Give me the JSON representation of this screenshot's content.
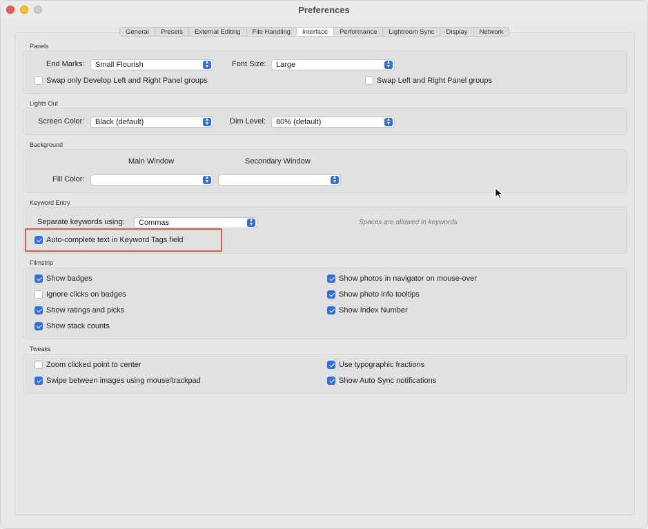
{
  "window": {
    "title": "Preferences"
  },
  "tabs": [
    "General",
    "Presets",
    "External Editing",
    "File Handling",
    "Interface",
    "Performance",
    "Lightroom Sync",
    "Display",
    "Network"
  ],
  "active_tab": "Interface",
  "panels": {
    "section_label": "Panels",
    "end_marks_label": "End Marks:",
    "end_marks_value": "Small Flourish",
    "font_size_label": "Font Size:",
    "font_size_value": "Large",
    "swap_develop": {
      "label": "Swap only Develop Left and Right Panel groups",
      "checked": false
    },
    "swap_lr": {
      "label": "Swap Left and Right Panel groups",
      "checked": false
    }
  },
  "lights_out": {
    "section_label": "Lights Out",
    "screen_color_label": "Screen Color:",
    "screen_color_value": "Black (default)",
    "dim_level_label": "Dim Level:",
    "dim_level_value": "80% (default)"
  },
  "background": {
    "section_label": "Background",
    "main_window_label": "Main Window",
    "secondary_window_label": "Secondary Window",
    "fill_color_label": "Fill Color:",
    "main_fill_value": "",
    "secondary_fill_value": ""
  },
  "keyword_entry": {
    "section_label": "Keyword Entry",
    "separate_label": "Separate keywords using:",
    "separate_value": "Commas",
    "hint": "Spaces are allowed in keywords",
    "autocomplete": {
      "label": "Auto-complete text in Keyword Tags field",
      "checked": true
    }
  },
  "filmstrip": {
    "section_label": "Filmstrip",
    "show_badges": {
      "label": "Show badges",
      "checked": true
    },
    "ignore_clicks": {
      "label": "Ignore clicks on badges",
      "checked": false
    },
    "show_ratings": {
      "label": "Show ratings and picks",
      "checked": true
    },
    "show_stack": {
      "label": "Show stack counts",
      "checked": true
    },
    "show_photos_nav": {
      "label": "Show photos in navigator on mouse-over",
      "checked": true
    },
    "show_photo_info": {
      "label": "Show photo info tooltips",
      "checked": true
    },
    "show_index": {
      "label": "Show Index Number",
      "checked": true
    }
  },
  "tweaks": {
    "section_label": "Tweaks",
    "zoom_clicked": {
      "label": "Zoom clicked point to center",
      "checked": false
    },
    "swipe": {
      "label": "Swipe between images using mouse/trackpad",
      "checked": true
    },
    "typographic": {
      "label": "Use typographic fractions",
      "checked": true
    },
    "auto_sync": {
      "label": "Show Auto Sync notifications",
      "checked": true
    }
  },
  "colors": {
    "accent": "#2f6fe0",
    "highlight": "#e0584a"
  }
}
